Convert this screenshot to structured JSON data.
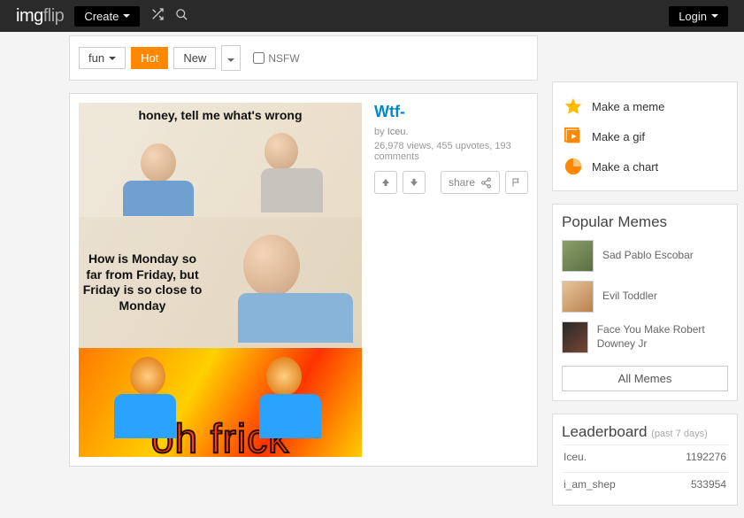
{
  "topbar": {
    "logo_a": "img",
    "logo_b": "flip",
    "create": "Create",
    "login": "Login"
  },
  "filters": {
    "stream": "fun",
    "hot": "Hot",
    "new": "New",
    "nsfw": "NSFW"
  },
  "post": {
    "title": "Wtf-",
    "by_prefix": "by ",
    "author": "Iceu.",
    "stats": "26,978 views, 455 upvotes, 193 comments",
    "share": "share",
    "caption1": "honey, tell me what's wrong",
    "caption2": "How is Monday so far from Friday, but Friday is so close to Monday",
    "caption3": "oh frick"
  },
  "side_actions": {
    "meme": "Make a meme",
    "gif": "Make a gif",
    "chart": "Make a chart"
  },
  "popular": {
    "title": "Popular Memes",
    "items": [
      "Sad Pablo Escobar",
      "Evil Toddler",
      "Face You Make Robert Downey Jr"
    ],
    "all": "All Memes"
  },
  "leaderboard": {
    "title": "Leaderboard",
    "subtitle": "(past 7 days)",
    "rows": [
      {
        "name": "Iceu.",
        "score": "1192276"
      },
      {
        "name": "i_am_shep",
        "score": "533954"
      }
    ]
  }
}
